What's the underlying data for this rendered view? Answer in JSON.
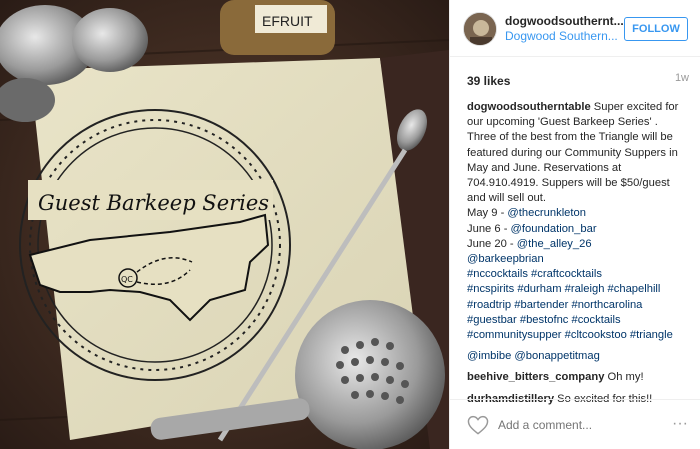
{
  "post": {
    "username": "dogwoodsouthernt...",
    "full_name": "Dogwood Southern...",
    "follow_label": "FOLLOW",
    "likes": "39 likes",
    "age": "1w",
    "photo": {
      "jar_label": "EFRUIT",
      "drawing_title": "Guest Barkeep Series",
      "map_circle_text": "QC"
    }
  },
  "caption": {
    "username": "dogwoodsoutherntable",
    "lines": [
      "Super excited for",
      "our upcoming 'Guest Barkeep Series' .",
      "Three of the best from the Triangle will be",
      "featured during our Community Suppers in",
      "May and June. Reservations at",
      "704.910.4919. Suppers will be $50/guest",
      "and will sell out."
    ],
    "dates": [
      {
        "date": "May 9 - ",
        "handle": "@thecrunkleton"
      },
      {
        "date": "June 6 - ",
        "handle": "@foundation_bar"
      },
      {
        "date": "June 20 - ",
        "handle": "@the_alley_26"
      }
    ],
    "tag_lines": [
      "@barkeepbrian",
      "#nccocktails #craftcocktails",
      "#ncspirits #durham #raleigh #chapelhill",
      "#roadtrip #bartender #northcarolina",
      "#guestbar #bestofnc #cocktails",
      "#communitysupper #cltcookstoo #triangle"
    ]
  },
  "comments": [
    {
      "username": "",
      "text": "@imbibe @bonappetitmag"
    },
    {
      "username": "beehive_bitters_company",
      "text": " Oh my!"
    },
    {
      "username": "durhamdistillery",
      "text": " So excited for this!!"
    }
  ],
  "footer": {
    "add_comment_placeholder": "Add a comment...",
    "more_label": "···"
  },
  "icons": {
    "heart": "heart-outline-icon",
    "more": "ellipsis-icon"
  },
  "colors": {
    "link": "#003569",
    "follow": "#3897f0",
    "muted": "#999999"
  }
}
